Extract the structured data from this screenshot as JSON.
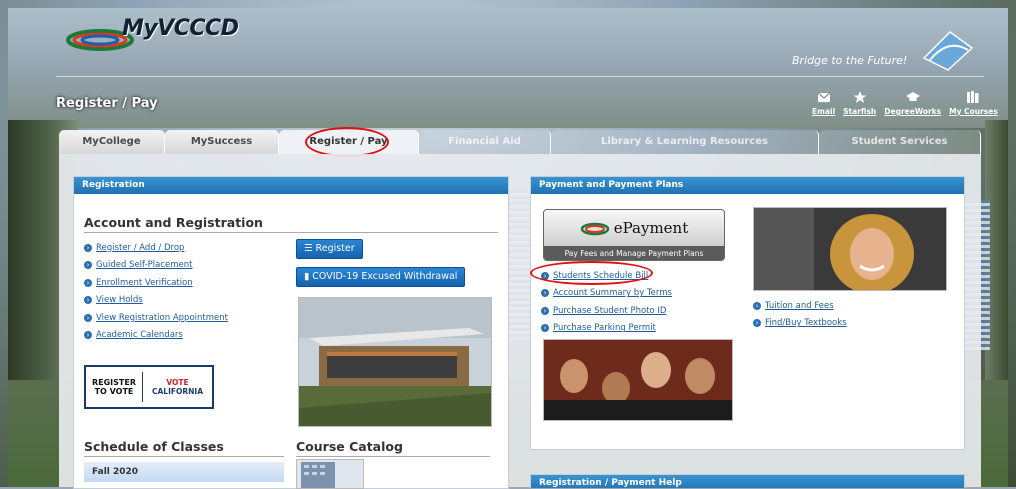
{
  "header": {
    "logo_text": "MyVCCCD",
    "tagline": "Bridge to the Future!",
    "page_title": "Register / Pay"
  },
  "quicklinks": [
    {
      "label": "Email",
      "icon": "envelope-icon"
    },
    {
      "label": "Starfish",
      "icon": "starfish-icon"
    },
    {
      "label": "DegreeWorks",
      "icon": "graduation-cap-icon"
    },
    {
      "label": "My Courses",
      "icon": "books-icon"
    }
  ],
  "tabs": [
    {
      "label": "MyCollege"
    },
    {
      "label": "MySuccess"
    },
    {
      "label": "Register / Pay"
    },
    {
      "label": "Financial Aid"
    },
    {
      "label": "Library & Learning Resources"
    },
    {
      "label": "Student Services"
    }
  ],
  "registration": {
    "panel_title": "Registration",
    "section_title": "Account and Registration",
    "links": [
      "Register / Add / Drop",
      "Guided Self-Placement",
      "Enrollment Verification",
      "View Holds",
      "View Registration Appointment",
      "Academic Calendars"
    ],
    "register_button": "Register",
    "covid_button": "COVID-19 Excused Withdrawal",
    "vote_badge": {
      "left": "REGISTER TO VOTE",
      "right_top": "VOTE",
      "right_bottom": "CALIFORNIA"
    },
    "schedule_title": "Schedule of Classes",
    "schedule_term": "Fall 2020",
    "catalog_title": "Course Catalog"
  },
  "payment": {
    "panel_title": "Payment and Payment Plans",
    "epayment_title": "ePayment",
    "epayment_sub": "Pay Fees and Manage Payment Plans",
    "links_left": [
      "Students Schedule Bill",
      "Account Summary by Terms",
      "Purchase Student Photo ID",
      "Purchase Parking Permit"
    ],
    "links_right": [
      "Tuition and Fees",
      "Find/Buy Textbooks"
    ],
    "help_title": "Registration / Payment Help"
  },
  "colors": {
    "accent": "#1f70b2",
    "highlight": "#e01010"
  }
}
